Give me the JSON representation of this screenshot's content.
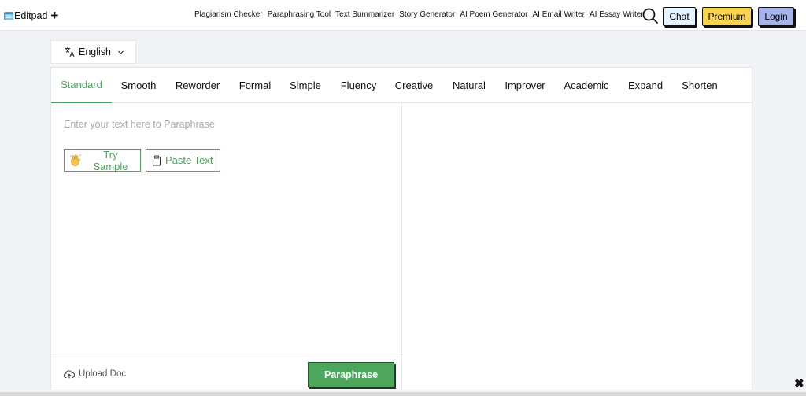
{
  "header": {
    "logo_text": "Editpad",
    "logo_plus": "+",
    "nav": [
      "Plagiarism Checker",
      "Paraphrasing Tool",
      "Text Summarizer",
      "Story Generator",
      "AI Poem Generator",
      "AI Email Writer",
      "AI Essay Writer"
    ],
    "chat_label": "Chat",
    "premium_label": "Premium",
    "login_label": "Login"
  },
  "language": {
    "selected": "English"
  },
  "tabs": [
    "Standard",
    "Smooth",
    "Reworder",
    "Formal",
    "Simple",
    "Fluency",
    "Creative",
    "Natural",
    "Improver",
    "Academic",
    "Expand",
    "Shorten"
  ],
  "active_tab": "Standard",
  "editor": {
    "placeholder": "Enter your text here to Paraphrase",
    "value": "",
    "try_sample_label": "Try Sample",
    "paste_text_label": "Paste Text",
    "upload_label": "Upload Doc",
    "paraphrase_label": "Paraphrase"
  },
  "close_glyph": "✖",
  "colors": {
    "accent_green": "#4ca65c",
    "chat_bg": "#e5f2ff",
    "premium_bg": "#f7d44c",
    "login_bg": "#a7b4e9",
    "page_bg": "#f1f3f6"
  },
  "icons": {
    "logo": "notepad-icon",
    "search": "search-icon",
    "language": "translate-icon",
    "chevron": "chevron-down-icon",
    "try_sample": "waving-hand-icon",
    "paste_text": "clipboard-icon",
    "upload": "cloud-upload-icon",
    "close": "close-icon"
  }
}
